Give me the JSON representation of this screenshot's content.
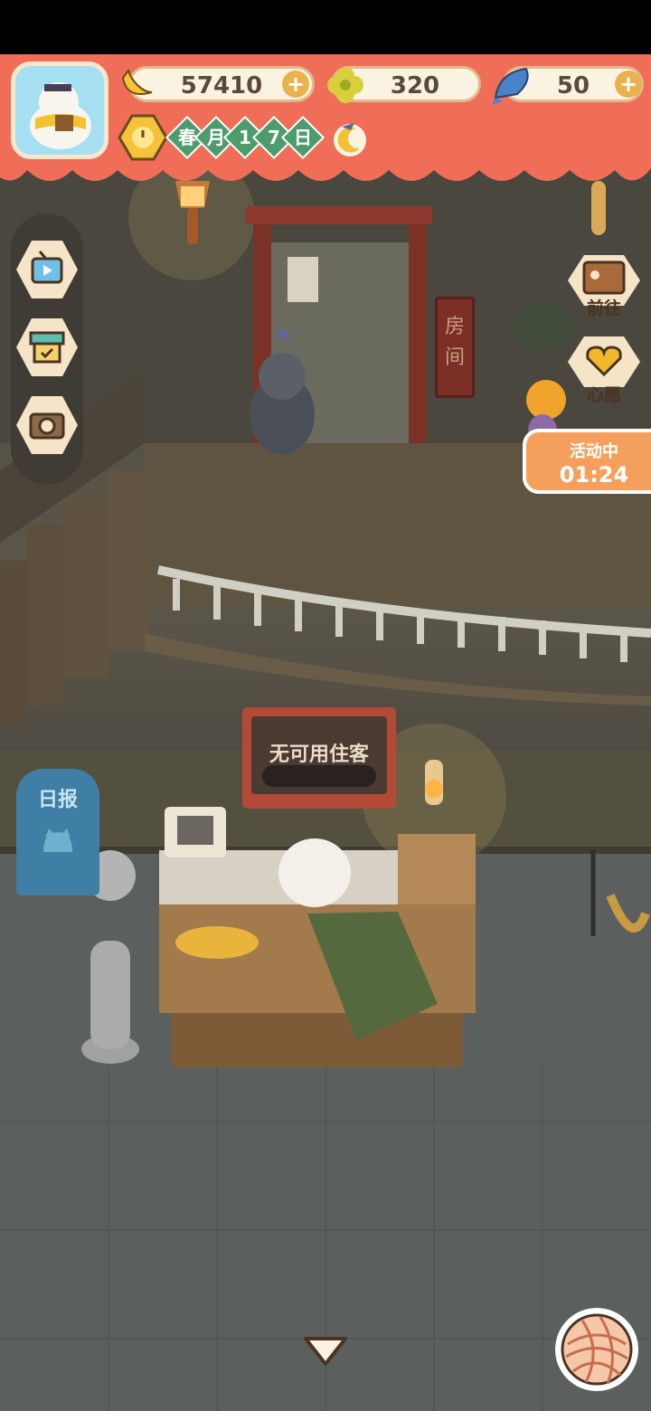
{
  "resources": {
    "bananas": "57410",
    "clovers": "320",
    "fish": "50"
  },
  "calendar": {
    "chars": [
      "春",
      "月",
      "1",
      "7",
      "日"
    ]
  },
  "hotel": {
    "room_sign": "房间",
    "desk_sign": "无可用住客",
    "newspaper_label": "日报"
  },
  "right_menu": {
    "goto_label": "前往",
    "wish_label": "心愿"
  },
  "event": {
    "status": "活动中",
    "timer": "01:24"
  },
  "colors": {
    "topbar": "#f06e58",
    "pill": "#fbf3e1",
    "calendar_green": "#4e9b6d",
    "event_orange": "#f4a05c"
  }
}
